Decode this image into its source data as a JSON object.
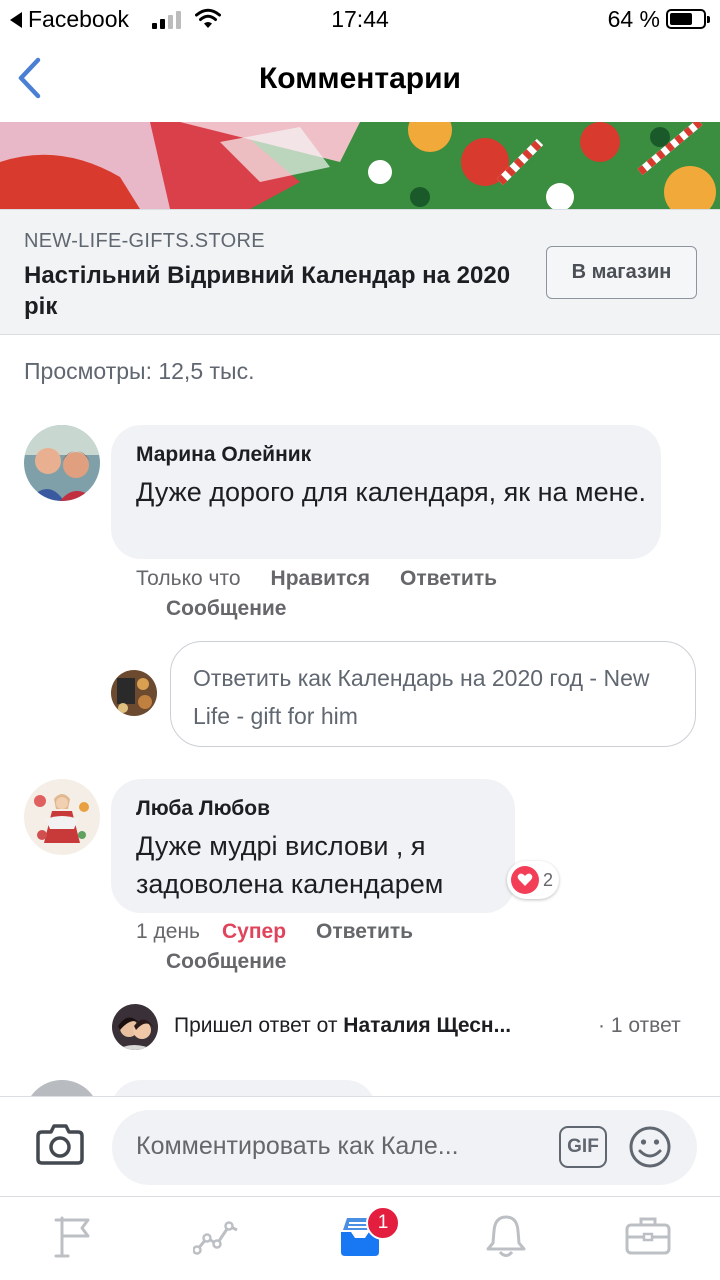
{
  "status_bar": {
    "back_app": "Facebook",
    "time": "17:44",
    "battery": "64 %"
  },
  "nav": {
    "title": "Комментарии"
  },
  "link_card": {
    "domain": "NEW-LIFE-GIFTS.STORE",
    "title": "Настільний Відривний Календар на 2020 рік",
    "button": "В магазин"
  },
  "views": "Просмотры: 12,5 тыс.",
  "comments": [
    {
      "author": "Марина Олейник",
      "text": "Дуже дорого для календаря, як на мене.",
      "time": "Только что",
      "like": "Нравится",
      "reply": "Ответить",
      "message": "Сообщение"
    },
    {
      "author": "Люба Любов",
      "text": "Дуже мудрі вислови , я задоволена календарем",
      "time": "1 день",
      "like": "Супер",
      "reply": "Ответить",
      "message": "Сообщение",
      "reaction_count": "2",
      "reply_thread": {
        "prefix": "Пришел ответ от ",
        "name": "Наталия Щесн...",
        "count": "· 1 ответ"
      }
    }
  ],
  "reply_box": {
    "placeholder": "Ответить как Календарь на 2020 год - New Life - gift for him"
  },
  "composer": {
    "placeholder": "Комментировать как Кале...",
    "gif": "GIF"
  },
  "tabbar": {
    "badge": "1"
  },
  "colors": {
    "accent": "#1877f2",
    "reaction_red": "#e0445c",
    "badge_red": "#e41e3f"
  }
}
